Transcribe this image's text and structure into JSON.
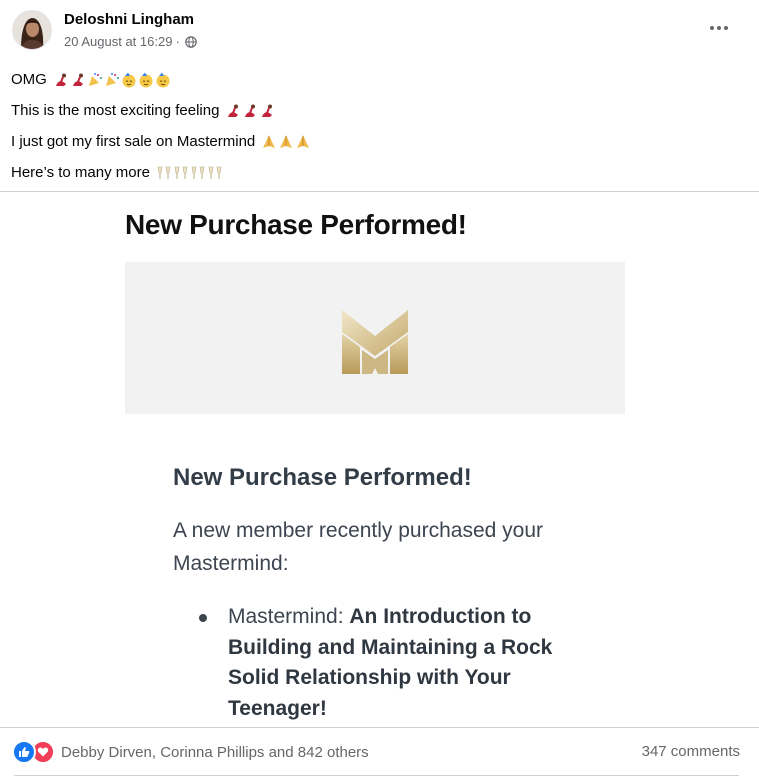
{
  "post": {
    "author": "Deloshni Lingham",
    "timestamp": "20 August at 16:29",
    "separator": "·",
    "audience_icon": "globe-icon",
    "lines": [
      {
        "text": "OMG",
        "emojis": [
          "dancer",
          "dancer",
          "confetti",
          "confetti",
          "partying-face",
          "partying-face",
          "partying-face"
        ]
      },
      {
        "text": "This is the most exciting feeling",
        "emojis": [
          "dancer",
          "dancer",
          "dancer"
        ]
      },
      {
        "text": "I just got my first sale on Mastermind",
        "emojis": [
          "folded-hands",
          "folded-hands",
          "folded-hands"
        ]
      },
      {
        "text": "Here’s to many more",
        "emojis": [
          "clinking-glasses",
          "clinking-glasses",
          "clinking-glasses",
          "clinking-glasses"
        ]
      }
    ]
  },
  "image": {
    "title": "New Purchase Performed!",
    "logo": "mastermind-m-logo",
    "heading": "New Purchase Performed!",
    "body": "A new member recently purchased your Mastermind:",
    "list_label": "Mastermind:",
    "list_item": "An Introduction to Building and Maintaining a Rock Solid Relationship with Your Teenager!"
  },
  "footer": {
    "reaction_icons": [
      "like-icon",
      "love-icon"
    ],
    "reaction_names": "Debby Dirven, Corinna Phillips and 842 others",
    "comments": "347 comments"
  },
  "colors": {
    "like": "#1877f2",
    "love": "#f33e58",
    "gold": "#c9b27a",
    "secondary_text": "#65676b"
  }
}
